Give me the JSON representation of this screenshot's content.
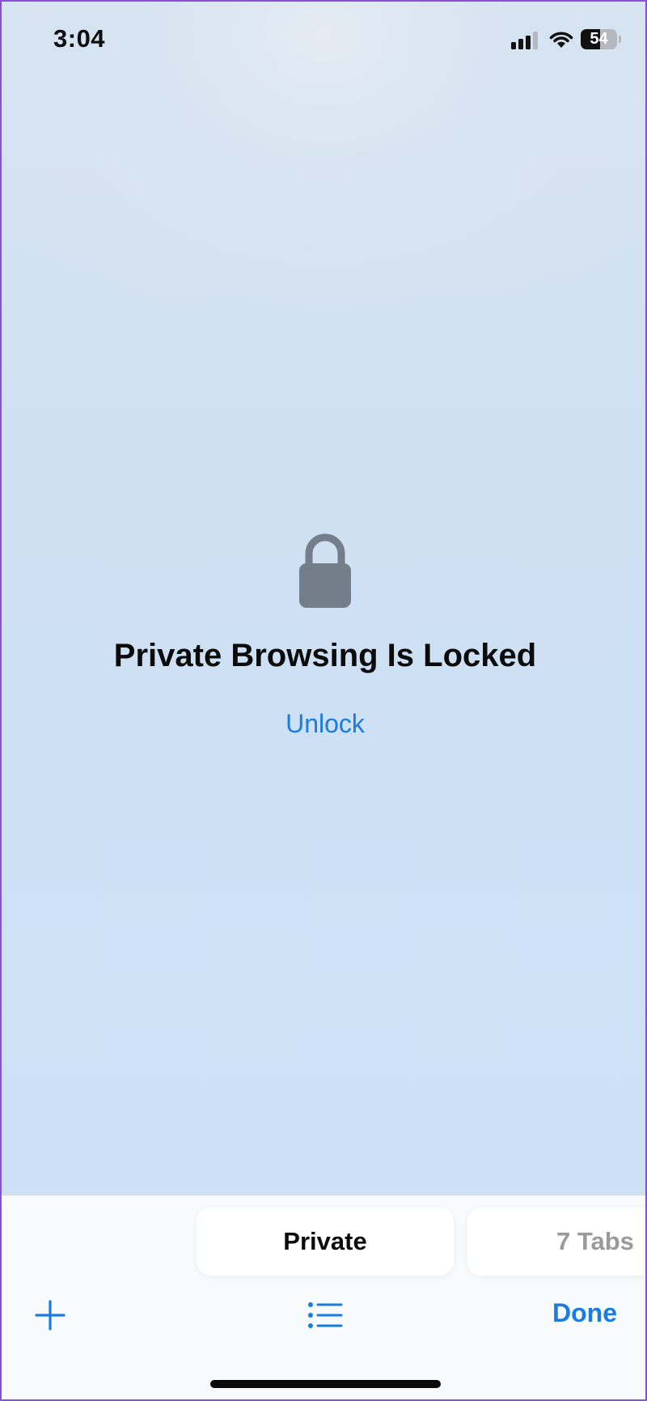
{
  "status_bar": {
    "time": "3:04",
    "battery_percent": "54",
    "battery_level": 0.54,
    "signal_icon": "cellular-signal-icon",
    "wifi_icon": "wifi-icon",
    "battery_icon": "battery-icon"
  },
  "lock_screen": {
    "icon": "lock-icon",
    "title": "Private Browsing Is Locked",
    "unlock_label": "Unlock"
  },
  "tab_groups": [
    {
      "label": "Private"
    },
    {
      "label": "7 Tabs"
    }
  ],
  "toolbar": {
    "new_tab_icon": "plus-icon",
    "tab_groups_icon": "list-icon",
    "done_label": "Done"
  },
  "colors": {
    "accent": "#1a7ce0",
    "lock_icon": "#747d8a",
    "background": "#cfe0f3"
  }
}
